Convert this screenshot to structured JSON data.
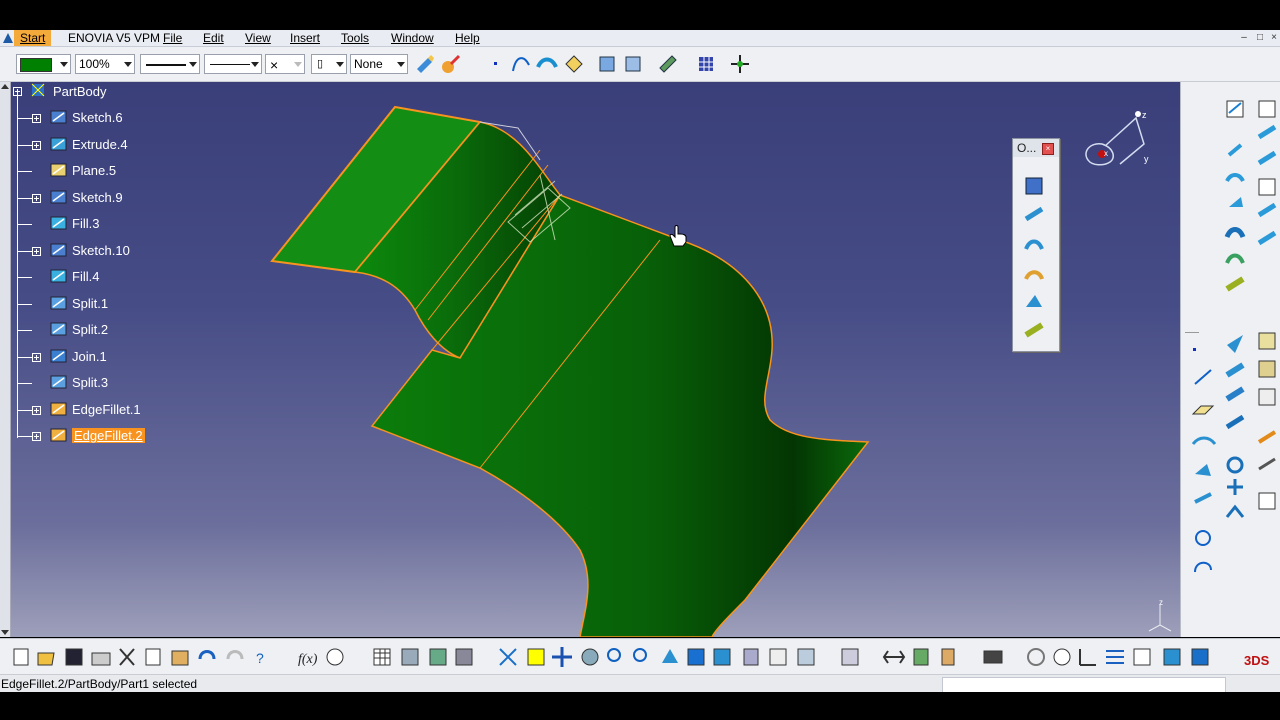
{
  "menu": {
    "start": "Start",
    "enovia": "ENOVIA V5 VPM",
    "items": [
      "File",
      "Edit",
      "View",
      "Insert",
      "Tools",
      "Window",
      "Help"
    ]
  },
  "toolbar": {
    "color_value": "",
    "color_swatch": "#008000",
    "transparency": "100%",
    "layer": "None"
  },
  "tree": {
    "root": "PartBody",
    "items": [
      {
        "label": "Sketch.6",
        "icon": "sketch-icon",
        "expand": true
      },
      {
        "label": "Extrude.4",
        "icon": "extrude-icon",
        "expand": true
      },
      {
        "label": "Plane.5",
        "icon": "plane-icon",
        "expand": false
      },
      {
        "label": "Sketch.9",
        "icon": "sketch-icon",
        "expand": true
      },
      {
        "label": "Fill.3",
        "icon": "fill-icon",
        "expand": false
      },
      {
        "label": "Sketch.10",
        "icon": "sketch-icon",
        "expand": true
      },
      {
        "label": "Fill.4",
        "icon": "fill-icon",
        "expand": false
      },
      {
        "label": "Split.1",
        "icon": "split-icon",
        "expand": false
      },
      {
        "label": "Split.2",
        "icon": "split-icon",
        "expand": false
      },
      {
        "label": "Join.1",
        "icon": "join-icon",
        "expand": true
      },
      {
        "label": "Split.3",
        "icon": "split-icon",
        "expand": false
      },
      {
        "label": "EdgeFillet.1",
        "icon": "edge-fillet-icon",
        "expand": true
      },
      {
        "label": "EdgeFillet.2",
        "icon": "edge-fillet-icon",
        "expand": true,
        "selected": true
      }
    ]
  },
  "floating_toolbar": {
    "title": "O..."
  },
  "compass": {
    "x": "x",
    "y": "y",
    "z": "z"
  },
  "status": {
    "text": "EdgeFillet.2/PartBody/Part1 selected"
  },
  "colors": {
    "surface": "#0a7a0a",
    "highlight": "#f7931e",
    "background_top": "#3a3f7a"
  }
}
